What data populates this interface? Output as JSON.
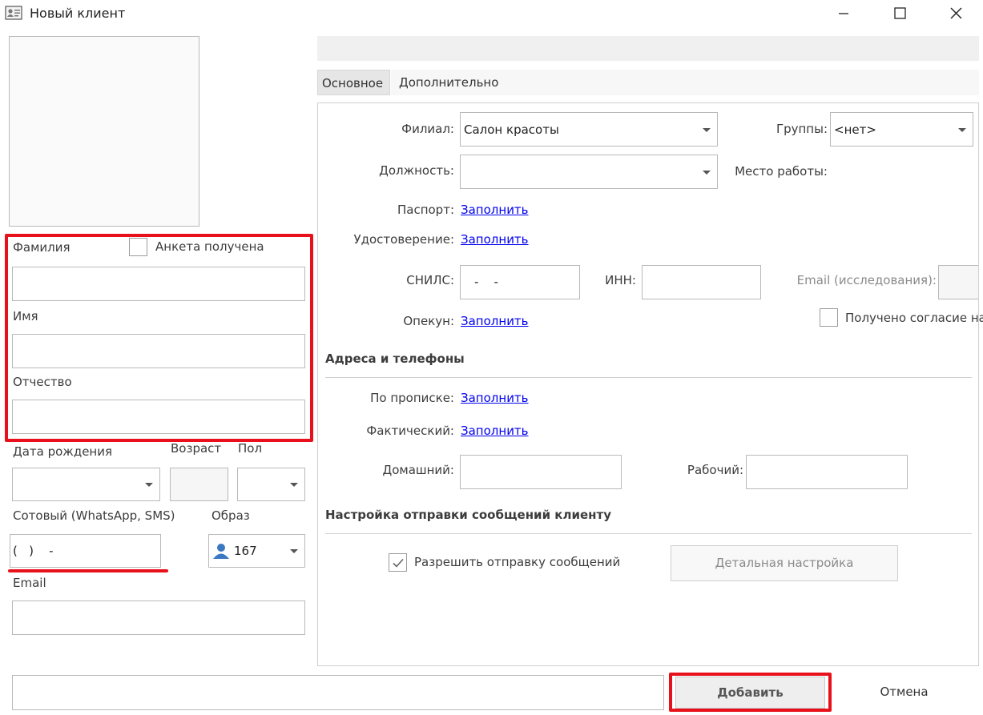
{
  "window": {
    "title": "Новый клиент",
    "icon": "contact-card-icon",
    "minimize_icon": "minimize-icon",
    "maximize_icon": "maximize-icon",
    "close_icon": "close-icon"
  },
  "left": {
    "photo_icon": "photo-placeholder",
    "surname_label": "Фамилия",
    "survey_label": "Анкета получена",
    "name_label": "Имя",
    "patronymic_label": "Отчество",
    "birthdate_label": "Дата рождения",
    "age_label": "Возраст",
    "gender_label": "Пол",
    "mobile_label": "Сотовый (WhatsApp, SMS)",
    "mobile_value": "(   )    -",
    "avatar_label": "Образ",
    "avatar_value": "167",
    "email_label": "Email"
  },
  "tabs": [
    {
      "label": "Основное",
      "active": true
    },
    {
      "label": "Дополнительно",
      "active": false
    }
  ],
  "main": {
    "branch_label": "Филиал:",
    "branch_value": "Салон красоты",
    "groups_label": "Группы:",
    "groups_value": "<нет>",
    "position_label": "Должность:",
    "workplace_label": "Место работы:",
    "passport_label": "Паспорт:",
    "passport_link": "Заполнить",
    "id_label": "Удостоверение:",
    "id_link": "Заполнить",
    "snils_label": "СНИЛС:",
    "snils_value": "-    -",
    "inn_label": "ИНН:",
    "email_research_label": "Email (исследования):",
    "guardian_label": "Опекун:",
    "guardian_link": "Заполнить",
    "consent_label": "Получено согласие на",
    "addresses_section": "Адреса и телефоны",
    "registration_label": "По прописке:",
    "registration_link": "Заполнить",
    "actual_label": "Фактический:",
    "actual_link": "Заполнить",
    "home_label": "Домашний:",
    "work_label": "Рабочий:",
    "messages_section": "Настройка отправки сообщений клиенту",
    "allow_messages_label": "Разрешить отправку сообщений",
    "allow_messages_checked": true,
    "detailed_settings_label": "Детальная настройка"
  },
  "footer": {
    "add_label": "Добавить",
    "cancel_label": "Отмена"
  },
  "colors": {
    "highlight": "#e8101a",
    "link": "#0000ee",
    "tab_active": "#e6e6e6"
  }
}
